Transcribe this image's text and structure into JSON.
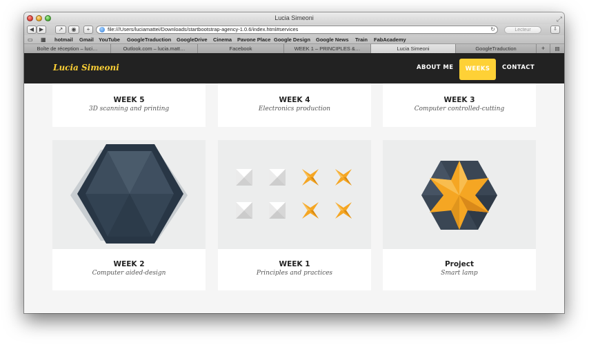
{
  "window": {
    "title": "Lucia Simeoni"
  },
  "toolbar": {
    "url": "file:///Users/luciamattei/Downloads/startbootstrap-agency-1.0.6/index.html#services",
    "reader_label": "Lecteur"
  },
  "bookmarks": [
    "hotmail",
    "Gmail",
    "YouTube",
    "GoogleTraduction",
    "GoogleDrive",
    "Cinema",
    "Pavone Place",
    "Google Design",
    "Google News",
    "Train",
    "FabAcademy"
  ],
  "tabs": [
    {
      "label": "Boîte de réception – luci…",
      "active": false
    },
    {
      "label": "Outlook.com – lucia.matt…",
      "active": false
    },
    {
      "label": "Facebook",
      "active": false
    },
    {
      "label": "WEEK 1 – PRINCIPLES &…",
      "active": false
    },
    {
      "label": "Lucia Simeoni",
      "active": true
    },
    {
      "label": "GoogleTraduction",
      "active": false
    }
  ],
  "navbar": {
    "brand": "Lucia Simeoni",
    "links": [
      "ABOUT ME",
      "WEEKS",
      "CONTACT"
    ],
    "active_link": "WEEKS"
  },
  "portfolio": {
    "row1": [
      {
        "title": "WEEK 5",
        "subtitle": "3D scanning and printing"
      },
      {
        "title": "WEEK 4",
        "subtitle": "Electronics production"
      },
      {
        "title": "WEEK 3",
        "subtitle": "Computer controlled-cutting"
      }
    ],
    "row2": [
      {
        "title": "WEEK 2",
        "subtitle": "Computer aided-design",
        "image": "hexagon-icon"
      },
      {
        "title": "WEEK 1",
        "subtitle": "Principles and practices",
        "image": "folded-squares-icon"
      },
      {
        "title": "Project",
        "subtitle": "Smart lamp",
        "image": "hexagon-star-icon"
      }
    ]
  },
  "colors": {
    "accent": "#fed136",
    "navbar": "#222222",
    "hex_dark": "#2d3a47",
    "star": "#f5a623"
  }
}
